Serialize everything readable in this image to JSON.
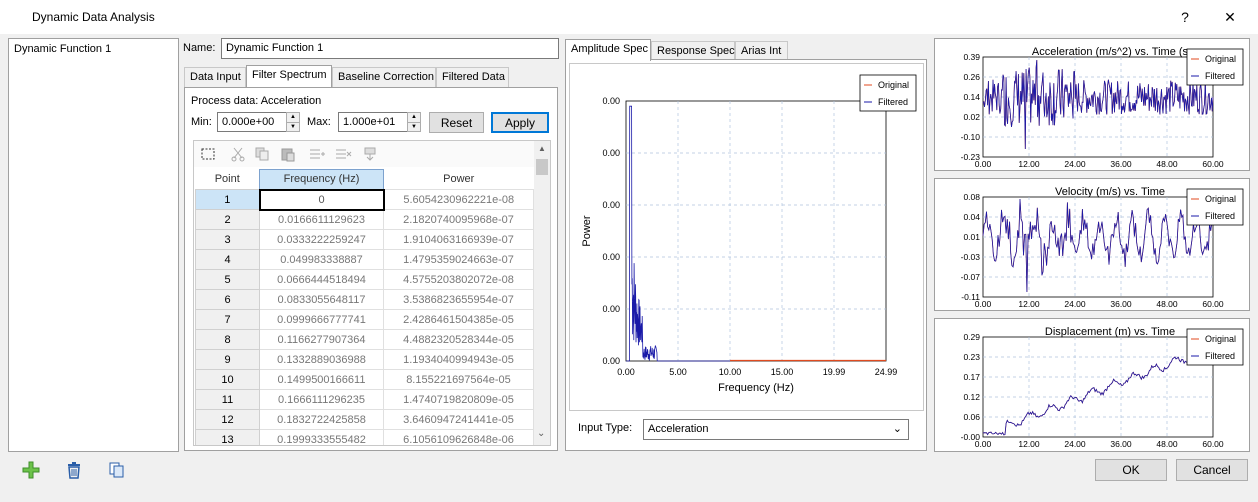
{
  "window": {
    "title": "Dynamic Data Analysis",
    "help": "?",
    "close": "✕"
  },
  "functions": {
    "items": [
      "Dynamic Function 1"
    ]
  },
  "name": {
    "label": "Name:",
    "value": "Dynamic Function 1"
  },
  "left_tabs": [
    "Data Input",
    "Filter Spectrum",
    "Baseline Correction",
    "Filtered Data"
  ],
  "process": {
    "label": "Process data: Acceleration"
  },
  "range": {
    "min_label": "Min:",
    "min_value": "0.000e+00",
    "max_label": "Max:",
    "max_value": "1.000e+01"
  },
  "buttons": {
    "reset": "Reset",
    "apply": "Apply",
    "ok": "OK",
    "cancel": "Cancel"
  },
  "table": {
    "headers": [
      "Point",
      "Frequency (Hz)",
      "Power"
    ],
    "rows": [
      [
        "1",
        "0",
        "5.6054230962221e-08"
      ],
      [
        "2",
        "0.0166611129623",
        "2.1820740095968e-07"
      ],
      [
        "3",
        "0.0333222259247",
        "1.9104063166939e-07"
      ],
      [
        "4",
        "0.049983338887",
        "1.4795359024663e-07"
      ],
      [
        "5",
        "0.0666444518494",
        "4.5755203802072e-08"
      ],
      [
        "6",
        "0.0833055648117",
        "3.5386823655954e-07"
      ],
      [
        "7",
        "0.0999666777741",
        "2.4286461504385e-05"
      ],
      [
        "8",
        "0.1166277907364",
        "4.4882320528344e-05"
      ],
      [
        "9",
        "0.1332889036988",
        "1.1934040994943e-05"
      ],
      [
        "10",
        "0.1499500166611",
        "8.155221697564e-05"
      ],
      [
        "11",
        "0.1666111296235",
        "1.4740719820809e-05"
      ],
      [
        "12",
        "0.1832722425858",
        "3.6460947241441e-05"
      ],
      [
        "13",
        "0.1999333555482",
        "6.1056109626848e-06"
      ]
    ]
  },
  "right_tabs": [
    "Amplitude Spec",
    "Response Spec",
    "Arias Int"
  ],
  "input_type": {
    "label": "Input Type:",
    "value": "Acceleration"
  },
  "colors": {
    "original": "#e04a1f",
    "filtered": "#1a1aa8",
    "grid": "#b0c4de"
  },
  "chart_data": [
    {
      "type": "line",
      "title": "",
      "xlabel": "Frequency (Hz)",
      "ylabel": "Power",
      "xticks": [
        "0.00",
        "5.00",
        "10.00",
        "15.00",
        "19.99",
        "24.99"
      ],
      "yticks": [
        "0.00",
        "0.00",
        "0.00",
        "0.00",
        "0.00",
        "0.00"
      ],
      "xlim": [
        0,
        24.99
      ],
      "series": [
        {
          "name": "Original"
        },
        {
          "name": "Filtered"
        }
      ],
      "legend": "top-right",
      "grid": true
    },
    {
      "type": "line",
      "title": "Acceleration (m/s^2) vs. Time (s",
      "xticks": [
        "0.00",
        "12.00",
        "24.00",
        "36.00",
        "48.00",
        "60.00"
      ],
      "yticks": [
        "0.39",
        "0.26",
        "0.14",
        "0.02",
        "-0.10",
        "-0.23"
      ],
      "xlim": [
        0,
        60
      ],
      "ylim": [
        -0.23,
        0.39
      ],
      "series": [
        {
          "name": "Original"
        },
        {
          "name": "Filtered"
        }
      ],
      "legend": "top-right",
      "grid": true
    },
    {
      "type": "line",
      "title": "Velocity (m/s) vs. Time",
      "xticks": [
        "0.00",
        "12.00",
        "24.00",
        "36.00",
        "48.00",
        "60.00"
      ],
      "yticks": [
        "0.08",
        "0.04",
        "0.01",
        "-0.03",
        "-0.07",
        "-0.11"
      ],
      "xlim": [
        0,
        60
      ],
      "ylim": [
        -0.11,
        0.08
      ],
      "series": [
        {
          "name": "Original"
        },
        {
          "name": "Filtered"
        }
      ],
      "legend": "top-right",
      "grid": true
    },
    {
      "type": "line",
      "title": "Displacement (m) vs. Time",
      "xticks": [
        "0.00",
        "12.00",
        "24.00",
        "36.00",
        "48.00",
        "60.00"
      ],
      "yticks": [
        "0.29",
        "0.23",
        "0.17",
        "0.12",
        "0.06",
        "-0.00"
      ],
      "xlim": [
        0,
        60
      ],
      "ylim": [
        0,
        0.29
      ],
      "series": [
        {
          "name": "Original"
        },
        {
          "name": "Filtered"
        }
      ],
      "legend": "top-right",
      "grid": true
    }
  ]
}
